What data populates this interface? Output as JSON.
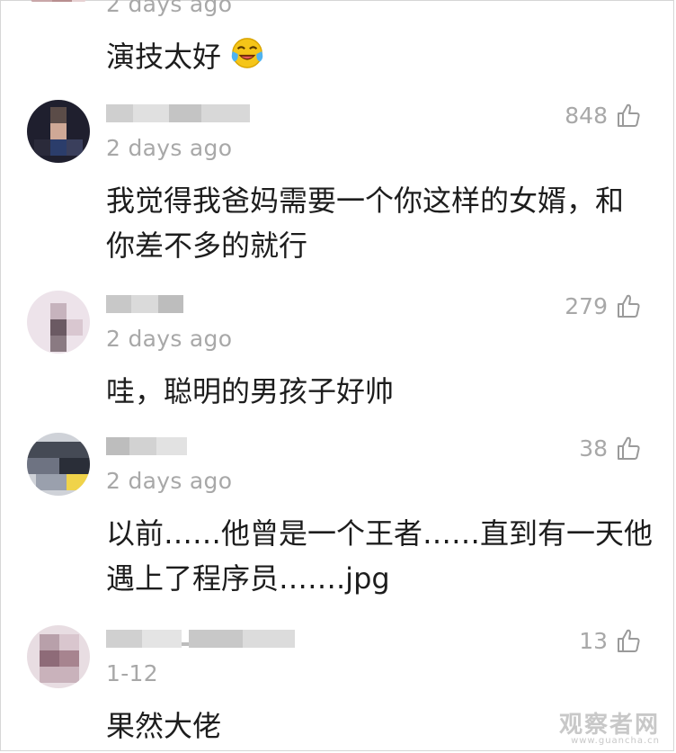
{
  "comments": [
    {
      "time": "2 days ago",
      "text_lines": [
        "演技太好"
      ],
      "emoji": "laughing-crying-emoji",
      "likes": null
    },
    {
      "time": "2 days ago",
      "text_lines": [
        "我觉得我爸妈需要一个你这样的女婿，和",
        "你差不多的就行"
      ],
      "likes": "848"
    },
    {
      "time": "2 days ago",
      "text_lines": [
        "哇，聪明的男孩子好帅"
      ],
      "likes": "279"
    },
    {
      "time": "2 days ago",
      "text_lines": [
        "以前……他曾是一个王者……直到有一天他",
        "遇上了程序员…….jpg"
      ],
      "likes": "38"
    },
    {
      "time": "1-12",
      "text_lines": [
        "果然大佬"
      ],
      "likes": "13"
    }
  ],
  "watermark": {
    "main": "观察者网",
    "sub": "www.guancha.cn"
  },
  "colors": {
    "meta_gray": "#a8a8a8",
    "text": "#1d1d1d",
    "divider": "#d6d6d6"
  }
}
